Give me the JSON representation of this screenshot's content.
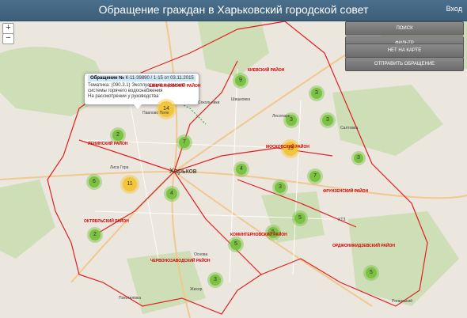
{
  "header": {
    "title": "Обращение граждан в Харьковский городской совет",
    "login": "Вход"
  },
  "zoom": {
    "in": "+",
    "out": "−"
  },
  "panel": {
    "buttons": [
      "ПОИСК",
      "ФИЛЬТР",
      "НЕТ НА КАРТЕ",
      "ОТПРАВИТЬ ОБРАЩЕНИЕ"
    ]
  },
  "popup": {
    "label": "Обращение №",
    "number": "К-11-39890 / 1-15 от 03.11.2015",
    "line1": "Тематика: (090.3.1) Эксплуатация и ремонт",
    "line2": "системы горячего водоснабжения",
    "line3": "На рассмотрении у руководства"
  },
  "clusters": [
    "14",
    "9",
    "3",
    "3",
    "3",
    "2",
    "7",
    "19",
    "4",
    "6",
    "11",
    "4",
    "7",
    "3",
    "5",
    "5",
    "2",
    "5",
    "3",
    "5",
    "3"
  ],
  "districts": [
    "ШЕВЧЕНКОВСКИЙ РАЙОН",
    "КИЕВСКИЙ РАЙОН",
    "ЛЕНИНСКИЙ РАЙОН",
    "МОСКОВСКИЙ РАЙОН",
    "ФРУНЗЕНСКИЙ РАЙОН",
    "ОКТЯБРЬСКИЙ РАЙОН",
    "КОМИНТЕРНОВСКИЙ РАЙОН",
    "ЧЕРВОНОЗАВОДСКИЙ РАЙОН",
    "ОРДЖОНИКИДЗЕВСКИЙ РАЙОН"
  ],
  "places": [
    "Павлово Поле",
    "Шишковка",
    "Харьков",
    "Лиса Гора",
    "Основа",
    "Покотилівка",
    "Жихор",
    "Роганський",
    "Сокольники",
    "Лесопарк",
    "ХТЗ",
    "Салтовка"
  ],
  "colors": {
    "header": "#4a6f8c",
    "district_border": "#e02020",
    "cluster_small": "#7bc142",
    "cluster_medium": "#f2c53a"
  }
}
